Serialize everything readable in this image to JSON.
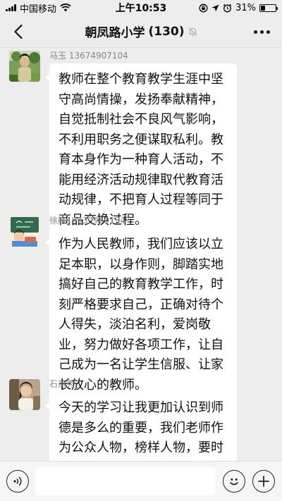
{
  "status_bar": {
    "carrier": "中国移动",
    "time": "上午10:53",
    "battery_percent": "31%",
    "battery_level": 0.31,
    "icons": [
      "signal-icon",
      "wifi-icon",
      "orientation-lock-icon",
      "location-icon",
      "alarm-icon",
      "battery-icon"
    ]
  },
  "nav": {
    "title": "朝凤路小学",
    "member_count": "(130)",
    "icons": [
      "back-icon",
      "mute-bell-icon",
      "more-icon"
    ]
  },
  "messages": [
    {
      "sender": "马玉 13674907104",
      "text": "教师在整个教育教学生涯中坚守高尚情操，发扬奉献精神，自觉抵制社会不良风气影响，不利用职务之便谋取私利。教育本身作为一种育人活动，不能用经济活动规律取代教育活动规律，不把育人过程等同于商品交换过程。",
      "avatar": "avatar-person-outdoor"
    },
    {
      "sender": "徐航19939960134",
      "text": "作为人民教师，我们应该以立足本职，以身作则，脚踏实地搞好自己的教育教学工作，时刻严格要求自己，正确对待个人得失，淡泊名利，爱岗敬业，努力做好各项工作，让自己成为一名让学生信服、让家长放心的教师。",
      "avatar": "avatar-cartoon-blackboard"
    },
    {
      "sender": "石燕秀",
      "text": "今天的学习让我更加认识到师德是多么的重要，我们老师作为公众人物，榜样人物，要时刻警醒自己，规范自己的言",
      "avatar": "avatar-person-photo"
    }
  ],
  "input_bar": {
    "placeholder": "",
    "icons": [
      "voice-icon",
      "emoji-icon",
      "plus-icon"
    ]
  },
  "colors": {
    "background": "#ededed",
    "bubble": "#ffffff",
    "sender_text": "#888888"
  }
}
